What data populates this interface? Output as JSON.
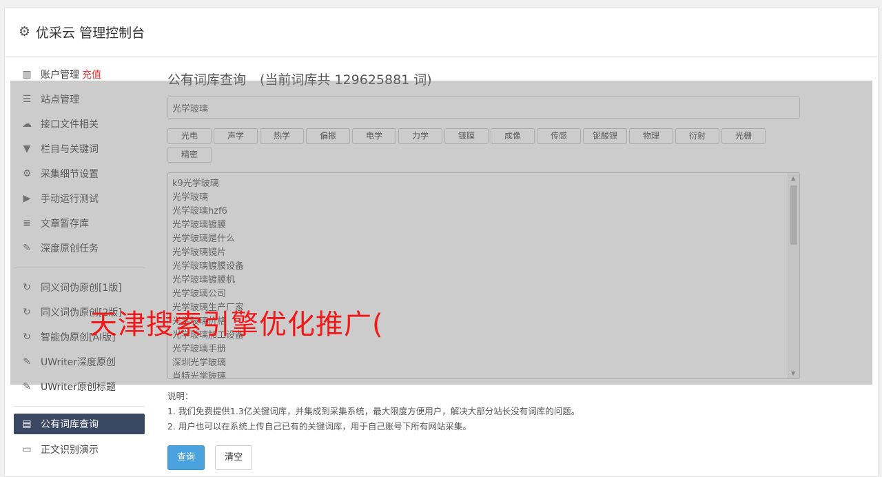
{
  "header": {
    "title": "优采云 管理控制台",
    "icon": "gear-icon"
  },
  "sidebar": {
    "group1": [
      {
        "label": "账户管理",
        "badge": "充值",
        "icon": "bar-chart-icon"
      },
      {
        "label": "站点管理",
        "icon": "server-icon"
      },
      {
        "label": "接口文件相关",
        "icon": "cloud-upload-icon"
      },
      {
        "label": "栏目与关键词",
        "icon": "filter-icon"
      },
      {
        "label": "采集细节设置",
        "icon": "cogs-icon"
      },
      {
        "label": "手动运行测试",
        "icon": "play-circle-icon"
      },
      {
        "label": "文章暂存库",
        "icon": "database-icon"
      },
      {
        "label": "深度原创任务",
        "icon": "edit-icon"
      }
    ],
    "group2": [
      {
        "label": "同义词伪原创[1版]",
        "icon": "refresh-icon"
      },
      {
        "label": "同义词伪原创[2版]",
        "icon": "refresh-icon"
      },
      {
        "label": "智能伪原创[AI版]",
        "icon": "refresh-icon"
      },
      {
        "label": "UWriter深度原创",
        "icon": "edit-icon"
      },
      {
        "label": "UWriter原创标题",
        "icon": "edit-icon"
      }
    ],
    "group3": [
      {
        "label": "公有词库查询",
        "icon": "book-icon",
        "active": true
      },
      {
        "label": "正文识别演示",
        "icon": "monitor-icon"
      }
    ]
  },
  "main": {
    "title": "公有词库查询",
    "count_text": "(当前词库共 129625881 词)",
    "search_value": "光学玻璃",
    "tags": [
      "光电",
      "声学",
      "热学",
      "偏振",
      "电学",
      "力学",
      "镀膜",
      "成像",
      "传感",
      "铌酸锂",
      "物理",
      "衍射",
      "光栅",
      "精密"
    ],
    "results": [
      "k9光学玻璃",
      "光学玻璃",
      "光学玻璃hzf6",
      "光学玻璃镀膜",
      "光学玻璃是什么",
      "光学玻璃镜片",
      "光学玻璃镀膜设备",
      "光学玻璃镀膜机",
      "光学玻璃公司",
      "光学玻璃生产厂家",
      "光学玻璃价格",
      "光学玻璃加工设备",
      "光学玻璃手册",
      "深圳光学玻璃",
      "肖特光学玻璃"
    ],
    "notes_title": "说明：",
    "notes": [
      "1. 我们免费提供1.3亿关键词库，并集成到采集系统，最大限度方便用户，解决大部分站长没有词库的问题。",
      "2. 用户也可以在系统上传自己已有的关键词库，用于自己账号下所有网站采集。"
    ],
    "query_label": "查询",
    "clear_label": "清空"
  },
  "watermark": "天津搜索引擎优化推广("
}
